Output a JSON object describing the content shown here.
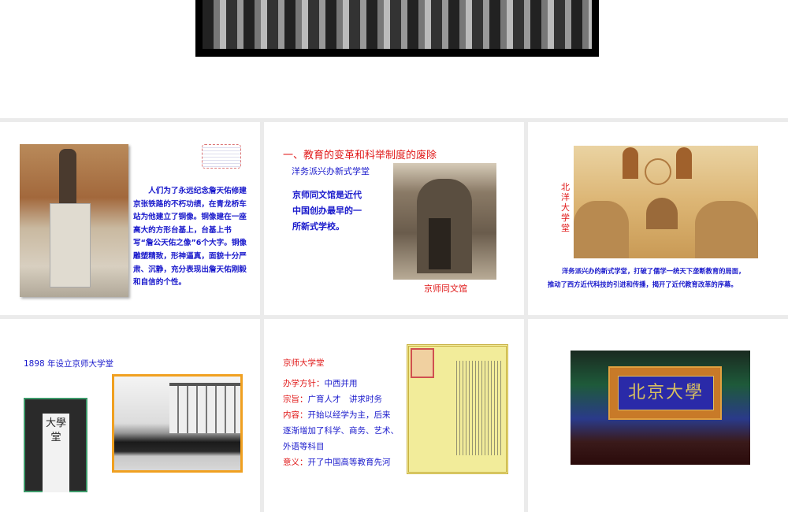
{
  "slides": [
    {
      "id": "prev"
    },
    {
      "text": "　　人们为了永远纪念詹天佑修建京张铁路的不朽功绩，在青龙桥车站为他建立了铜像。铜像建在一座高大的方形台基上，台基上书写“詹公天佑之像”6个大字。铜像雕塑精致，形神逼真，面貌十分严肃、沉静，充分表现出詹天佑刚毅和自信的个性。"
    },
    {
      "heading": "一、教育的变革和科举制度的废除",
      "subtitle": "洋务派兴办新式学堂",
      "body_lines": [
        "京师同文馆是近代",
        "中国创办最早的一",
        "所新式学校。"
      ],
      "caption": "京师同文馆"
    },
    {
      "vertical_label": [
        "北",
        "洋",
        "大",
        "学",
        "堂"
      ],
      "caption_lines": [
        "洋务派兴办的新式学堂，打破了儒学一统天下垄断教育的局面，",
        "推动了西方近代科技的引进和传播，揭开了近代教育改革的序幕。"
      ]
    },
    {
      "title": "1898 年设立京师大学堂",
      "plaque_text": "大學堂"
    },
    {
      "title": "京师大学堂",
      "items": [
        {
          "label": "办学方针：",
          "value": "中西并用"
        },
        {
          "label": "宗旨：",
          "value": "广育人才　讲求时务"
        },
        {
          "label": "内容：",
          "value": "开始以经学为主，后来"
        },
        {
          "label": "",
          "value": "逐渐增加了科学、商务、艺术、"
        },
        {
          "label": "",
          "value": "外语等科目"
        },
        {
          "label": "意义：",
          "value": "开了中国高等教育先河"
        }
      ]
    },
    {
      "plaque_text": "北京大學"
    }
  ]
}
